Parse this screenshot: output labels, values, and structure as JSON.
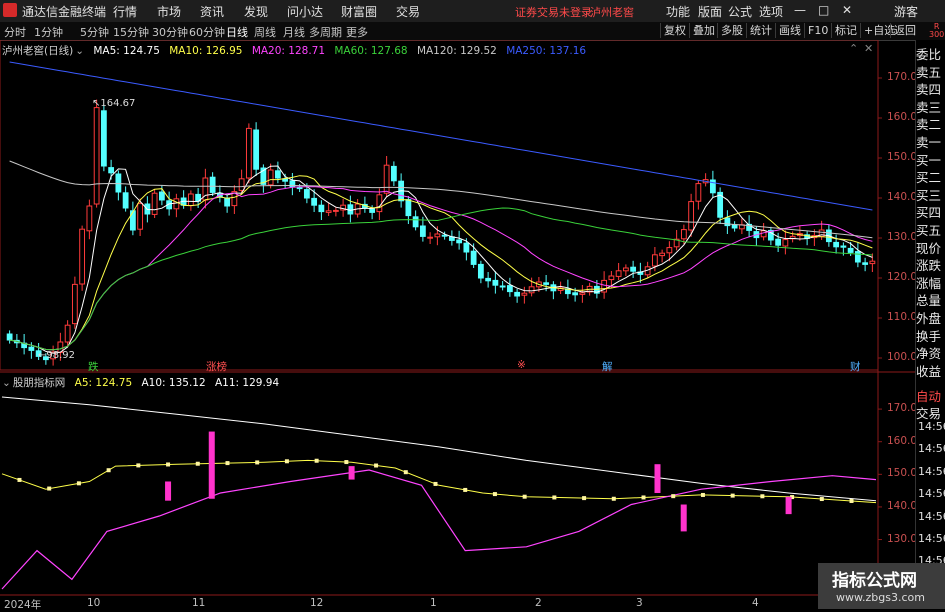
{
  "menubar": {
    "app_title": "通达信金融终端",
    "items": [
      "行情",
      "市场",
      "资讯",
      "发现",
      "问小达",
      "财富圈",
      "交易"
    ],
    "alert": "证券交易未登录",
    "stock_name": "泸州老窖",
    "right_items": [
      "功能",
      "版面",
      "公式",
      "选项"
    ],
    "window_buttons": [
      "—",
      "□",
      "✕"
    ],
    "guest": "游客"
  },
  "tabbar": {
    "periods": [
      "分时",
      "1分钟",
      "5分钟",
      "15分钟",
      "30分钟",
      "60分钟",
      "日线",
      "周线",
      "月线",
      "多周期",
      "更多"
    ],
    "active_period": "日线",
    "buttons": [
      "复权",
      "叠加",
      "多股",
      "统计",
      "画线",
      "F10",
      "标记",
      "+自选",
      "返回"
    ]
  },
  "main_info": {
    "name": "泸州老窖(日线)",
    "ma": [
      {
        "label": "MA5: 124.75",
        "color": "#ffffff"
      },
      {
        "label": "MA10: 126.95",
        "color": "#ffff4a"
      },
      {
        "label": "MA20: 128.71",
        "color": "#ff44ff"
      },
      {
        "label": "MA60: 127.68",
        "color": "#3ad13a"
      },
      {
        "label": "MA120: 129.52",
        "color": "#c8c8c8"
      },
      {
        "label": "MA250: 137.16",
        "color": "#3b5bff"
      }
    ]
  },
  "sub_info": {
    "name": "股朋指标网",
    "items": [
      {
        "label": "A5: 124.75",
        "color": "#ffff4a"
      },
      {
        "label": "A10: 135.12",
        "color": "#ffffff"
      },
      {
        "label": "A11: 129.94",
        "color": "#ffffff"
      }
    ]
  },
  "right_panel": {
    "top_badge": "R",
    "top_badge2": "300",
    "items": [
      "委比",
      "卖五",
      "卖四",
      "卖三",
      "卖二",
      "卖一",
      "买一",
      "买二",
      "买三",
      "买四",
      "买五",
      "现价",
      "涨跌",
      "涨幅",
      "总量",
      "外盘",
      "换手",
      "净资",
      "收益",
      "自动",
      "交易"
    ]
  },
  "sub_axis_times": [
    "14:56",
    "14:56",
    "14:56",
    "14:56",
    "14:56",
    "14:56",
    "14:56",
    "14:56"
  ],
  "events": [
    {
      "label": "跌",
      "color": "#3ad13a"
    },
    {
      "label": "涨榜",
      "color": "#ff5050"
    },
    {
      "label": "※",
      "color": "#ff5050"
    },
    {
      "label": "解",
      "color": "#50b0ff"
    },
    {
      "label": "财",
      "color": "#50b0ff"
    }
  ],
  "x_labels": [
    "2024年",
    "10",
    "11",
    "12",
    "1",
    "2",
    "3",
    "4"
  ],
  "watermark": {
    "title": "指标公式网",
    "url": "www.zbgs3.com"
  },
  "chart_data": [
    {
      "type": "candlestick",
      "title": "泸州老窖(日线)",
      "y_axis_ticks": [
        170.0,
        160.0,
        150.0,
        140.0,
        130.0,
        120.0,
        110.0,
        100.0
      ],
      "ylim": [
        97,
        177
      ],
      "annotations": [
        {
          "label": "164.67",
          "value": 164.67
        },
        {
          "label": "98.92",
          "value": 98.92
        }
      ],
      "x_labels": [
        "2024年",
        "10",
        "11",
        "12",
        "1",
        "2",
        "3",
        "4"
      ],
      "series": [
        {
          "name": "MA5",
          "color": "#ffffff"
        },
        {
          "name": "MA10",
          "color": "#ffff4a"
        },
        {
          "name": "MA20",
          "color": "#ff44ff"
        },
        {
          "name": "MA60",
          "color": "#3ad13a"
        },
        {
          "name": "MA120",
          "color": "#c8c8c8"
        },
        {
          "name": "MA250",
          "color": "#3b5bff"
        }
      ],
      "closes": [
        104.5,
        103.8,
        102.6,
        101.9,
        100.4,
        99.6,
        101.5,
        104.0,
        108.2,
        118.4,
        132.2,
        138.0,
        162.6,
        148.0,
        146.3,
        141.5,
        137.5,
        132.0,
        138.6,
        136.0,
        141.2,
        139.5,
        137.3,
        139.8,
        138.2,
        141.0,
        139.2,
        145.0,
        141.4,
        140.2,
        138.0,
        141.6,
        144.8,
        157.4,
        147.2,
        143.4,
        147.0,
        145.0,
        144.2,
        142.8,
        142.4,
        140.0,
        138.2,
        136.6,
        136.8,
        136.9,
        138.2,
        136.0,
        138.5,
        137.6,
        136.4,
        140.8,
        148.2,
        144.3,
        139.3,
        135.6,
        132.8,
        130.4,
        130.2,
        131.0,
        130.5,
        129.4,
        128.8,
        126.5,
        123.4,
        120.0,
        119.3,
        118.2,
        117.8,
        116.6,
        115.5,
        116.2,
        117.8,
        119.0,
        118.4,
        116.8,
        117.5,
        116.1,
        115.8,
        116.3,
        117.9,
        116.2,
        119.4,
        120.5,
        121.8,
        122.5,
        121.7,
        120.9,
        122.8,
        125.8,
        126.2,
        127.6,
        129.7,
        132.1,
        139.1,
        143.6,
        144.6,
        141.3,
        135.2,
        133.1,
        132.5,
        133.3,
        131.9,
        130.1,
        131.8,
        129.5,
        128.2,
        129.6,
        130.4,
        131.1,
        129.9,
        130.6,
        132.0,
        129.1,
        127.8,
        127.7,
        126.4,
        124.0,
        123.4,
        124.2
      ],
      "opens": [
        106.0,
        104.4,
        103.7,
        102.7,
        101.8,
        100.3,
        99.8,
        101.4,
        104.0,
        108.6,
        118.5,
        131.8,
        138.5,
        161.8,
        147.6,
        146.0,
        141.3,
        136.8,
        132.2,
        138.5,
        135.9,
        141.5,
        139.3,
        137.3,
        140.0,
        138.1,
        140.9,
        139.5,
        145.2,
        141.2,
        140.0,
        138.1,
        141.9,
        145.0,
        157.0,
        147.5,
        143.3,
        146.8,
        144.8,
        144.3,
        142.6,
        142.1,
        139.9,
        138.2,
        136.4,
        136.7,
        137.0,
        138.3,
        136.0,
        138.4,
        137.3,
        136.6,
        141.2,
        147.9,
        144.2,
        139.6,
        135.3,
        133.0,
        130.2,
        130.3,
        130.7,
        130.3,
        129.5,
        128.7,
        126.7,
        123.4,
        119.9,
        119.4,
        118.0,
        118.1,
        116.4,
        115.7,
        116.3,
        117.8,
        118.8,
        118.3,
        116.9,
        117.3,
        116.3,
        115.9,
        116.5,
        117.9,
        116.5,
        119.6,
        120.4,
        121.8,
        122.7,
        121.5,
        120.8,
        123.0,
        125.6,
        126.3,
        127.8,
        129.8,
        132.0,
        139.2,
        143.8,
        144.5,
        141.4,
        135.0,
        133.3,
        132.3,
        133.4,
        131.6,
        130.3,
        131.9,
        129.7,
        128.0,
        129.8,
        130.6,
        130.8,
        130.1,
        130.4,
        132.0,
        128.9,
        128.0,
        127.4,
        126.6,
        123.8,
        123.6
      ]
    },
    {
      "type": "line",
      "title": "股朋指标网",
      "y_axis_ticks": [
        170.0,
        160.0,
        150.0,
        140.0,
        130.0,
        120.0
      ],
      "ylim": [
        113,
        178
      ],
      "series": [
        {
          "name": "A5",
          "color": "#ffff4a"
        },
        {
          "name": "A10",
          "color": "#ffffff"
        },
        {
          "name": "A11",
          "color": "#ffffff"
        }
      ],
      "a10_points": [
        [
          0,
          1.0
        ],
        [
          0.1,
          0.96
        ],
        [
          0.2,
          0.91
        ],
        [
          0.3,
          0.86
        ],
        [
          0.4,
          0.8
        ],
        [
          0.5,
          0.74
        ],
        [
          0.6,
          0.67
        ],
        [
          0.7,
          0.61
        ],
        [
          0.8,
          0.55
        ],
        [
          0.9,
          0.5
        ],
        [
          1.0,
          0.46
        ]
      ],
      "a5_points": [
        [
          0,
          0.6
        ],
        [
          0.05,
          0.52
        ],
        [
          0.1,
          0.56
        ],
        [
          0.13,
          0.64
        ],
        [
          0.2,
          0.65
        ],
        [
          0.3,
          0.66
        ],
        [
          0.35,
          0.67
        ],
        [
          0.4,
          0.66
        ],
        [
          0.45,
          0.63
        ],
        [
          0.5,
          0.54
        ],
        [
          0.55,
          0.5
        ],
        [
          0.6,
          0.48
        ],
        [
          0.7,
          0.47
        ],
        [
          0.8,
          0.49
        ],
        [
          0.9,
          0.48
        ],
        [
          1.0,
          0.45
        ]
      ],
      "a11_points": [
        [
          0,
          0.0
        ],
        [
          0.04,
          0.2
        ],
        [
          0.08,
          0.05
        ],
        [
          0.12,
          0.3
        ],
        [
          0.18,
          0.38
        ],
        [
          0.25,
          0.5
        ],
        [
          0.33,
          0.56
        ],
        [
          0.42,
          0.62
        ],
        [
          0.48,
          0.54
        ],
        [
          0.53,
          0.2
        ],
        [
          0.6,
          0.22
        ],
        [
          0.66,
          0.3
        ],
        [
          0.72,
          0.44
        ],
        [
          0.8,
          0.52
        ],
        [
          0.88,
          0.56
        ],
        [
          0.95,
          0.59
        ],
        [
          1.0,
          0.57
        ]
      ],
      "pink_bars": [
        {
          "x": 0.19,
          "top": 0.56,
          "bot": 0.46
        },
        {
          "x": 0.24,
          "top": 0.82,
          "bot": 0.47
        },
        {
          "x": 0.4,
          "top": 0.64,
          "bot": 0.57
        },
        {
          "x": 0.75,
          "top": 0.65,
          "bot": 0.5
        },
        {
          "x": 0.78,
          "top": 0.44,
          "bot": 0.3
        },
        {
          "x": 0.9,
          "top": 0.48,
          "bot": 0.39
        }
      ]
    }
  ]
}
